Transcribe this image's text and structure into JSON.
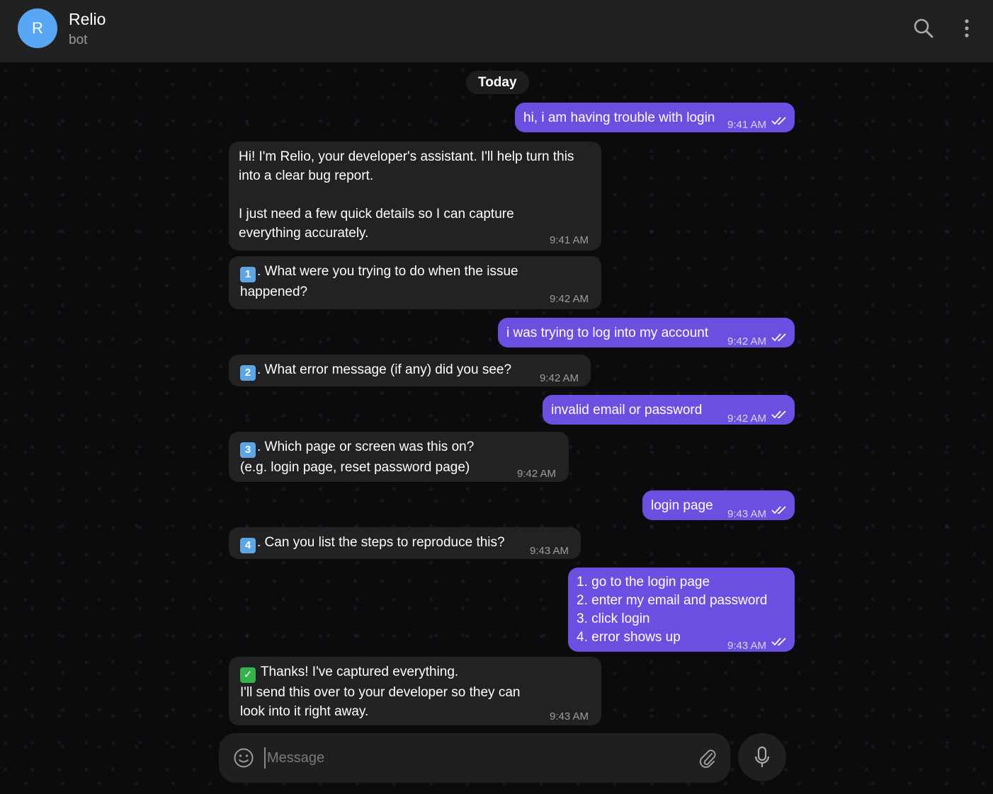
{
  "header": {
    "avatar_letter": "R",
    "title": "Relio",
    "subtitle": "bot",
    "avatar_color": "#58a7f5"
  },
  "chat": {
    "date_label": "Today",
    "messages": [
      {
        "from": "me",
        "text": "hi, i am having trouble with login",
        "time": "9:41 AM",
        "status": "read"
      },
      {
        "from": "bot",
        "text": "Hi! I'm Relio, your developer's assistant. I'll help turn this\ninto a clear bug report.\n\nI just need a few quick details so I can capture\neverything accurately.",
        "time": "9:41 AM"
      },
      {
        "from": "bot",
        "emoji": "1",
        "text": ". What were you trying to do when the issue\nhappened?",
        "time": "9:42 AM"
      },
      {
        "from": "me",
        "text": "i was trying to log into my account",
        "time": "9:42 AM",
        "status": "read"
      },
      {
        "from": "bot",
        "emoji": "2",
        "text": ". What error message (if any) did you see?",
        "time": "9:42 AM"
      },
      {
        "from": "me",
        "text": "invalid email or password",
        "time": "9:42 AM",
        "status": "read"
      },
      {
        "from": "bot",
        "emoji": "3",
        "text": ". Which page or screen was this on?\n(e.g. login page, reset password page)",
        "time": "9:42 AM"
      },
      {
        "from": "me",
        "text": "login page",
        "time": "9:43 AM",
        "status": "read"
      },
      {
        "from": "bot",
        "emoji": "4",
        "text": ". Can you list the steps to reproduce this?",
        "time": "9:43 AM"
      },
      {
        "from": "me",
        "text": "1. go to the login page\n2. enter my email and password\n3. click login\n4. error shows up",
        "time": "9:43 AM",
        "status": "read"
      },
      {
        "from": "bot",
        "emoji": "check",
        "text": " Thanks! I've captured everything.\nI'll send this over to your developer so they can\nlook into it right away.",
        "time": "9:43 AM"
      }
    ]
  },
  "composer": {
    "placeholder": "Message",
    "emoji_icon": "smile-icon",
    "attach_icon": "paperclip-icon",
    "mic_icon": "microphone-icon"
  },
  "colors": {
    "outgoing_bubble": "#6a4fe0",
    "incoming_bubble": "#222224",
    "header_bg": "#212121"
  }
}
